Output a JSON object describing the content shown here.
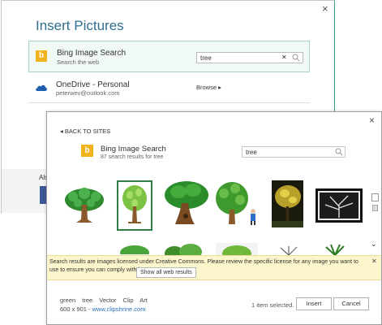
{
  "back_dialog": {
    "title": "Insert Pictures",
    "close": "×",
    "bing": {
      "name": "Bing Image Search",
      "sub": "Search the web",
      "search_value": "tree",
      "clear": "✕",
      "search_icon": "magnifier-icon"
    },
    "onedrive": {
      "name": "OneDrive - Personal",
      "sub": "peterwev@outlook.com",
      "browse": "Browse ▸"
    },
    "also_text": "Als"
  },
  "front_dialog": {
    "close": "×",
    "back_to_sites": "◂ BACK TO SITES",
    "bing_title": "Bing Image Search",
    "bing_results": "87 search results for tree",
    "search_value": "tree",
    "notice": {
      "text": "Search results are images licensed under Creative Commons. Please review the specific license for any image you want to use to ensure you can comply with it.",
      "show_all": "Show all web results",
      "close": "✕"
    },
    "meta": {
      "tags": "green  tree  Vector Clip Art",
      "size": "600 x 901 - ",
      "link": "www.clipshrine.com"
    },
    "selected_count": "1 item selected.",
    "insert_label": "Insert",
    "cancel_label": "Cancel",
    "scroll_down": "⌄"
  }
}
